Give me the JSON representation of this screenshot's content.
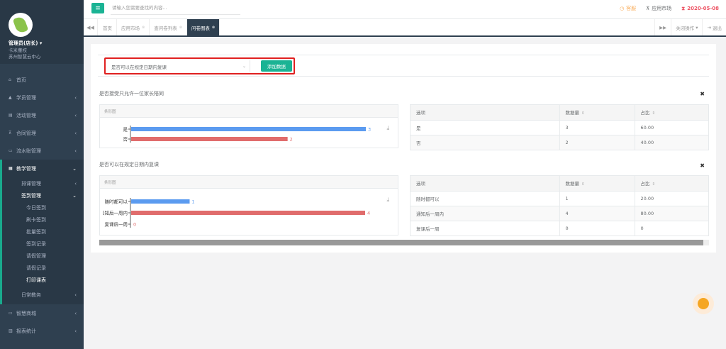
{
  "user": {
    "name": "管理员(店长)",
    "role": "卡米董校",
    "org": "苏州智慧云中心"
  },
  "sidebar": {
    "items": [
      {
        "label": "首页",
        "icon": "home-icon"
      },
      {
        "label": "学员管理",
        "icon": "graduation-cap-icon"
      },
      {
        "label": "活动管理",
        "icon": "map-icon"
      },
      {
        "label": "合同管理",
        "icon": "cart-icon"
      },
      {
        "label": "流水账管理",
        "icon": "money-icon"
      },
      {
        "label": "教学管理",
        "icon": "book-icon"
      }
    ],
    "teaching_sub": {
      "schedule": "排课管理",
      "checkin": "签到管理",
      "checkin_items": [
        "今日签到",
        "刷卡签到",
        "批量签到",
        "签到记录",
        "请假管理",
        "请假记录",
        "打印课表"
      ],
      "daily": "日常教务"
    },
    "bottom_items": [
      {
        "label": "智慧商城",
        "icon": "shop-icon"
      },
      {
        "label": "报表统计",
        "icon": "chart-icon"
      }
    ]
  },
  "topbar": {
    "search_placeholder": "请输入您需要查找的内容...",
    "service": "客服",
    "market": "应用市场",
    "date": "2020-05-08"
  },
  "tabs": {
    "items": [
      "首页",
      "应用市场",
      "查问卷列表",
      "问卷图表"
    ],
    "active_index": 3,
    "close_ops": "关闭操作",
    "logout": "退出"
  },
  "filter": {
    "selected": "是否可以在规定日期内复课",
    "add_button": "添加数据"
  },
  "questions": [
    {
      "title": "是否接受只允许一位家长陪同",
      "chart_label": "条形图",
      "table_headers": [
        "选项",
        "数据量",
        "占比"
      ],
      "rows": [
        {
          "option": "是",
          "count": "3",
          "ratio": "60.00"
        },
        {
          "option": "否",
          "count": "2",
          "ratio": "40.00"
        }
      ]
    },
    {
      "title": "是否可以在规定日期内复课",
      "chart_label": "条形图",
      "table_headers": [
        "选项",
        "数据量",
        "占比"
      ],
      "rows": [
        {
          "option": "随时都可以",
          "count": "1",
          "ratio": "20.00"
        },
        {
          "option": "通知后一周内",
          "count": "4",
          "ratio": "80.00"
        },
        {
          "option": "复课后一周",
          "count": "0",
          "ratio": "0"
        }
      ]
    }
  ],
  "chart_data": [
    {
      "type": "bar",
      "orientation": "horizontal",
      "categories": [
        "是",
        "否"
      ],
      "category_labels": [
        "是",
        "否"
      ],
      "values": [
        3,
        2
      ],
      "colors": [
        "#5b9bf0",
        "#e06c6c"
      ],
      "xlim": [
        0,
        3
      ]
    },
    {
      "type": "bar",
      "orientation": "horizontal",
      "categories": [
        "随时都可以",
        "通知后一周内",
        "复课后一周"
      ],
      "category_labels": [
        "随时都可以",
        "[知后一周内",
        "复课后一周"
      ],
      "values": [
        1,
        4,
        0
      ],
      "colors": [
        "#5b9bf0",
        "#e06c6c",
        "#e06c6c"
      ],
      "xlim": [
        0,
        4
      ]
    }
  ]
}
